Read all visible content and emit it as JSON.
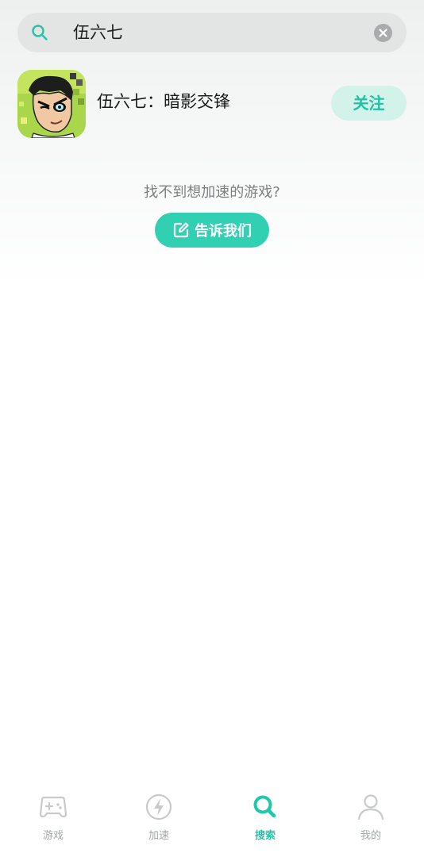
{
  "search": {
    "query": "伍六七"
  },
  "result": {
    "title": "伍六七：暗影交锋",
    "follow_label": "关注"
  },
  "hint": {
    "text": "找不到想加速的游戏?",
    "button_label": "告诉我们"
  },
  "tabs": [
    {
      "label": "游戏",
      "icon": "gamepad-icon",
      "active": false
    },
    {
      "label": "加速",
      "icon": "lightning-icon",
      "active": false
    },
    {
      "label": "搜索",
      "icon": "search-icon",
      "active": true
    },
    {
      "label": "我的",
      "icon": "person-icon",
      "active": false
    }
  ],
  "colors": {
    "accent": "#1ec3a6",
    "accent_button": "#31d0b2",
    "follow_bg": "#d3f2ea",
    "inactive_tab": "#a3a6a7"
  }
}
